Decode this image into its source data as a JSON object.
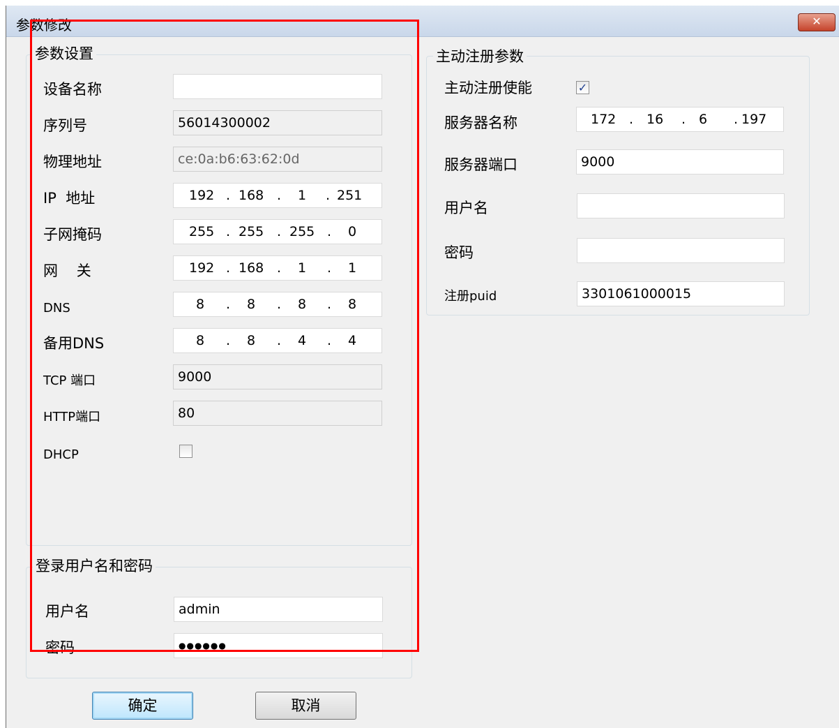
{
  "window": {
    "title": "参数修改",
    "close_symbol": "✕"
  },
  "params": {
    "group_title": "参数设置",
    "device_name": {
      "label": "设备名称",
      "value": ""
    },
    "serial": {
      "label": "序列号",
      "value": "56014300002"
    },
    "mac": {
      "label": "物理地址",
      "value": "ce:0a:b6:63:62:0d"
    },
    "ip": {
      "label": "IP  地址",
      "octets": [
        "192",
        "168",
        "1",
        "251"
      ]
    },
    "subnet": {
      "label": "子网掩码",
      "octets": [
        "255",
        "255",
        "255",
        "0"
      ]
    },
    "gateway": {
      "label": "网    关",
      "octets": [
        "192",
        "168",
        "1",
        "1"
      ]
    },
    "dns": {
      "label": "DNS",
      "octets": [
        "8",
        "8",
        "8",
        "8"
      ]
    },
    "dns2": {
      "label": "备用DNS",
      "octets": [
        "8",
        "8",
        "4",
        "4"
      ]
    },
    "tcp_port": {
      "label": "TCP 端口",
      "value": "9000"
    },
    "http_port": {
      "label": "HTTP端口",
      "value": "80"
    },
    "dhcp": {
      "label": "DHCP",
      "checked": false
    }
  },
  "login": {
    "group_title": "登录用户名和密码",
    "username": {
      "label": "用户名",
      "value": "admin"
    },
    "password": {
      "label": "密码",
      "value": "●●●●●●"
    }
  },
  "register": {
    "group_title": "主动注册参数",
    "enable": {
      "label": "主动注册使能",
      "checked": true,
      "mark": "✓"
    },
    "server_name": {
      "label": "服务器名称",
      "octets": [
        "172",
        "16",
        "6",
        "197"
      ]
    },
    "server_port": {
      "label": "服务器端口",
      "value": "9000"
    },
    "username": {
      "label": "用户名",
      "value": ""
    },
    "password": {
      "label": "密码",
      "value": ""
    },
    "puid": {
      "label": "注册puid",
      "value": "3301061000015"
    }
  },
  "buttons": {
    "ok": "确定",
    "cancel": "取消"
  },
  "ip_dot": "."
}
